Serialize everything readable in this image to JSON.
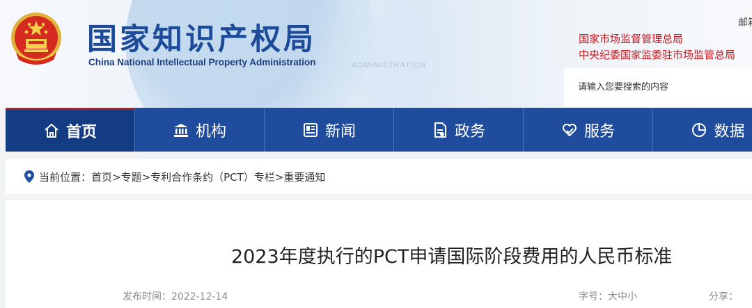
{
  "header": {
    "logo_cn": "国家知识产权局",
    "logo_en": "China National Intellectual Property Administration",
    "mail_link": "邮箱",
    "gov_links": [
      "国家市场监督管理总局",
      "中央纪委国家监委驻市场监管总局"
    ],
    "search_placeholder": "请输入您要搜索的内容"
  },
  "nav": {
    "items": [
      {
        "label": "首页",
        "icon": "home-icon",
        "active": true
      },
      {
        "label": "机构",
        "icon": "institution-icon",
        "active": false
      },
      {
        "label": "新闻",
        "icon": "news-icon",
        "active": false
      },
      {
        "label": "政务",
        "icon": "government-affairs-icon",
        "active": false
      },
      {
        "label": "服务",
        "icon": "service-icon",
        "active": false
      },
      {
        "label": "数据",
        "icon": "data-chart-icon",
        "active": false
      }
    ]
  },
  "breadcrumb": {
    "text": "当前位置：首页>专题>专利合作条约（PCT）专栏>重要通知"
  },
  "article": {
    "title": "2023年度执行的PCT申请国际阶段费用的人民币标准",
    "publish_label": "发布时间：",
    "publish_date": "2022-12-14",
    "font_size_label": "字号：",
    "font_sizes": [
      "大",
      "中",
      "小"
    ],
    "share_label": "分享："
  },
  "colors": {
    "brand_blue": "#1f4c9c",
    "nav_active": "#143c82",
    "accent_red": "#c8161d"
  }
}
